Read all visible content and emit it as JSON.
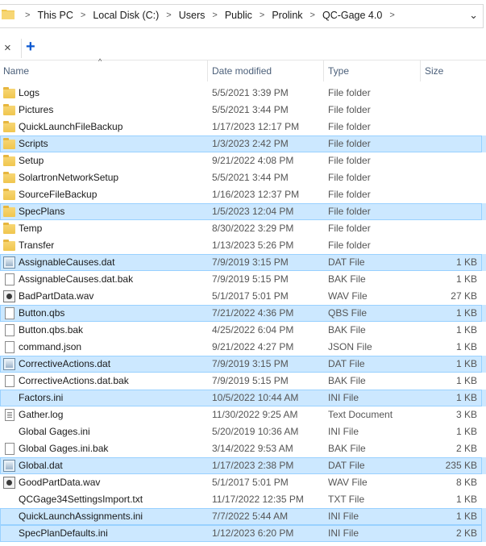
{
  "address_bar": {
    "segments": [
      "This PC",
      "Local Disk (C:)",
      "Users",
      "Public",
      "Prolink",
      "QC-Gage 4.0"
    ]
  },
  "tabs": {
    "close_glyph": "×",
    "add_glyph": "+"
  },
  "columns": {
    "name": "Name",
    "date_modified": "Date modified",
    "type": "Type",
    "size": "Size"
  },
  "rows": [
    {
      "name": "Logs",
      "date": "5/5/2021 3:39 PM",
      "type": "File folder",
      "size": "",
      "icon": "folder",
      "selected": false
    },
    {
      "name": "Pictures",
      "date": "5/5/2021 3:44 PM",
      "type": "File folder",
      "size": "",
      "icon": "folder",
      "selected": false
    },
    {
      "name": "QuickLaunchFileBackup",
      "date": "1/17/2023 12:17 PM",
      "type": "File folder",
      "size": "",
      "icon": "folder",
      "selected": false
    },
    {
      "name": "Scripts",
      "date": "1/3/2023 2:42 PM",
      "type": "File folder",
      "size": "",
      "icon": "folder",
      "selected": true
    },
    {
      "name": "Setup",
      "date": "9/21/2022 4:08 PM",
      "type": "File folder",
      "size": "",
      "icon": "folder",
      "selected": false
    },
    {
      "name": "SolartronNetworkSetup",
      "date": "5/5/2021 3:44 PM",
      "type": "File folder",
      "size": "",
      "icon": "folder",
      "selected": false
    },
    {
      "name": "SourceFileBackup",
      "date": "1/16/2023 12:37 PM",
      "type": "File folder",
      "size": "",
      "icon": "folder",
      "selected": false
    },
    {
      "name": "SpecPlans",
      "date": "1/5/2023 12:04 PM",
      "type": "File folder",
      "size": "",
      "icon": "folder",
      "selected": true
    },
    {
      "name": "Temp",
      "date": "8/30/2022 3:29 PM",
      "type": "File folder",
      "size": "",
      "icon": "folder",
      "selected": false
    },
    {
      "name": "Transfer",
      "date": "1/13/2023 5:26 PM",
      "type": "File folder",
      "size": "",
      "icon": "folder",
      "selected": false
    },
    {
      "name": "AssignableCauses.dat",
      "date": "7/9/2019 3:15 PM",
      "type": "DAT File",
      "size": "1 KB",
      "icon": "dat",
      "selected": true
    },
    {
      "name": "AssignableCauses.dat.bak",
      "date": "7/9/2019 5:15 PM",
      "type": "BAK File",
      "size": "1 KB",
      "icon": "bak",
      "selected": false
    },
    {
      "name": "BadPartData.wav",
      "date": "5/1/2017 5:01 PM",
      "type": "WAV File",
      "size": "27 KB",
      "icon": "wav",
      "selected": false
    },
    {
      "name": "Button.qbs",
      "date": "7/21/2022 4:36 PM",
      "type": "QBS File",
      "size": "1 KB",
      "icon": "doc",
      "selected": true
    },
    {
      "name": "Button.qbs.bak",
      "date": "4/25/2022 6:04 PM",
      "type": "BAK File",
      "size": "1 KB",
      "icon": "bak",
      "selected": false
    },
    {
      "name": "command.json",
      "date": "9/21/2022 4:27 PM",
      "type": "JSON File",
      "size": "1 KB",
      "icon": "json",
      "selected": false
    },
    {
      "name": "CorrectiveActions.dat",
      "date": "7/9/2019 3:15 PM",
      "type": "DAT File",
      "size": "1 KB",
      "icon": "dat",
      "selected": true
    },
    {
      "name": "CorrectiveActions.dat.bak",
      "date": "7/9/2019 5:15 PM",
      "type": "BAK File",
      "size": "1 KB",
      "icon": "bak",
      "selected": false
    },
    {
      "name": "Factors.ini",
      "date": "10/5/2022 10:44 AM",
      "type": "INI File",
      "size": "1 KB",
      "icon": "sublime",
      "selected": true
    },
    {
      "name": "Gather.log",
      "date": "11/30/2022 9:25 AM",
      "type": "Text Document",
      "size": "3 KB",
      "icon": "txt",
      "selected": false
    },
    {
      "name": "Global Gages.ini",
      "date": "5/20/2019 10:36 AM",
      "type": "INI File",
      "size": "1 KB",
      "icon": "sublime",
      "selected": false
    },
    {
      "name": "Global Gages.ini.bak",
      "date": "3/14/2022 9:53 AM",
      "type": "BAK File",
      "size": "2 KB",
      "icon": "bak",
      "selected": false
    },
    {
      "name": "Global.dat",
      "date": "1/17/2023 2:38 PM",
      "type": "DAT File",
      "size": "235 KB",
      "icon": "dat",
      "selected": true
    },
    {
      "name": "GoodPartData.wav",
      "date": "5/1/2017 5:01 PM",
      "type": "WAV File",
      "size": "8 KB",
      "icon": "wav",
      "selected": false
    },
    {
      "name": "QCGage34SettingsImport.txt",
      "date": "11/17/2022 12:35 PM",
      "type": "TXT File",
      "size": "1 KB",
      "icon": "sublime",
      "selected": false
    },
    {
      "name": "QuickLaunchAssignments.ini",
      "date": "7/7/2022 5:44 AM",
      "type": "INI File",
      "size": "1 KB",
      "icon": "sublime",
      "selected": true
    },
    {
      "name": "SpecPlanDefaults.ini",
      "date": "1/12/2023 6:20 PM",
      "type": "INI File",
      "size": "2 KB",
      "icon": "sublime",
      "selected": true
    }
  ]
}
